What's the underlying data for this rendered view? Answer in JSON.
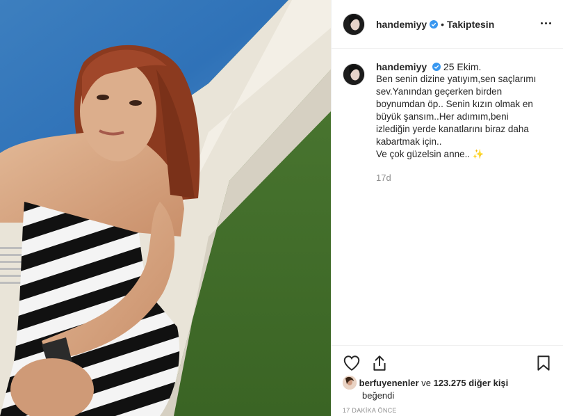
{
  "post": {
    "username": "handemiyy",
    "follow_label": "Takiptesin",
    "dot": "•",
    "caption": {
      "username": "handemiyy",
      "intro": "25 Ekim.",
      "lines": [
        "Ben senin dizine yatıyım,sen saçlarımı",
        "sev.Yanından geçerken birden",
        "boynumdan öp.. Senin kızın olmak en",
        "büyük şansım..Her adımım,beni",
        "izlediğin yerde kanatlarını biraz daha",
        "kabartmak için..",
        "Ve çok güzelsin anne.."
      ],
      "sparkle": "✨",
      "ago": "17d"
    },
    "likes": {
      "first_liker": "berfuyenenler",
      "connector": "ve",
      "others": "123.275 diğer kişi",
      "suffix": "beğendi"
    },
    "timestamp": "17 DAKİKA ÖNCE"
  },
  "icons": {
    "verified": "verified-badge-icon",
    "more": "more-options-icon",
    "like": "heart-icon",
    "share": "share-icon",
    "save": "bookmark-icon"
  },
  "colors": {
    "verified": "#3897f0",
    "text": "#262626",
    "muted": "#8e8e8e",
    "border": "#efefef"
  }
}
